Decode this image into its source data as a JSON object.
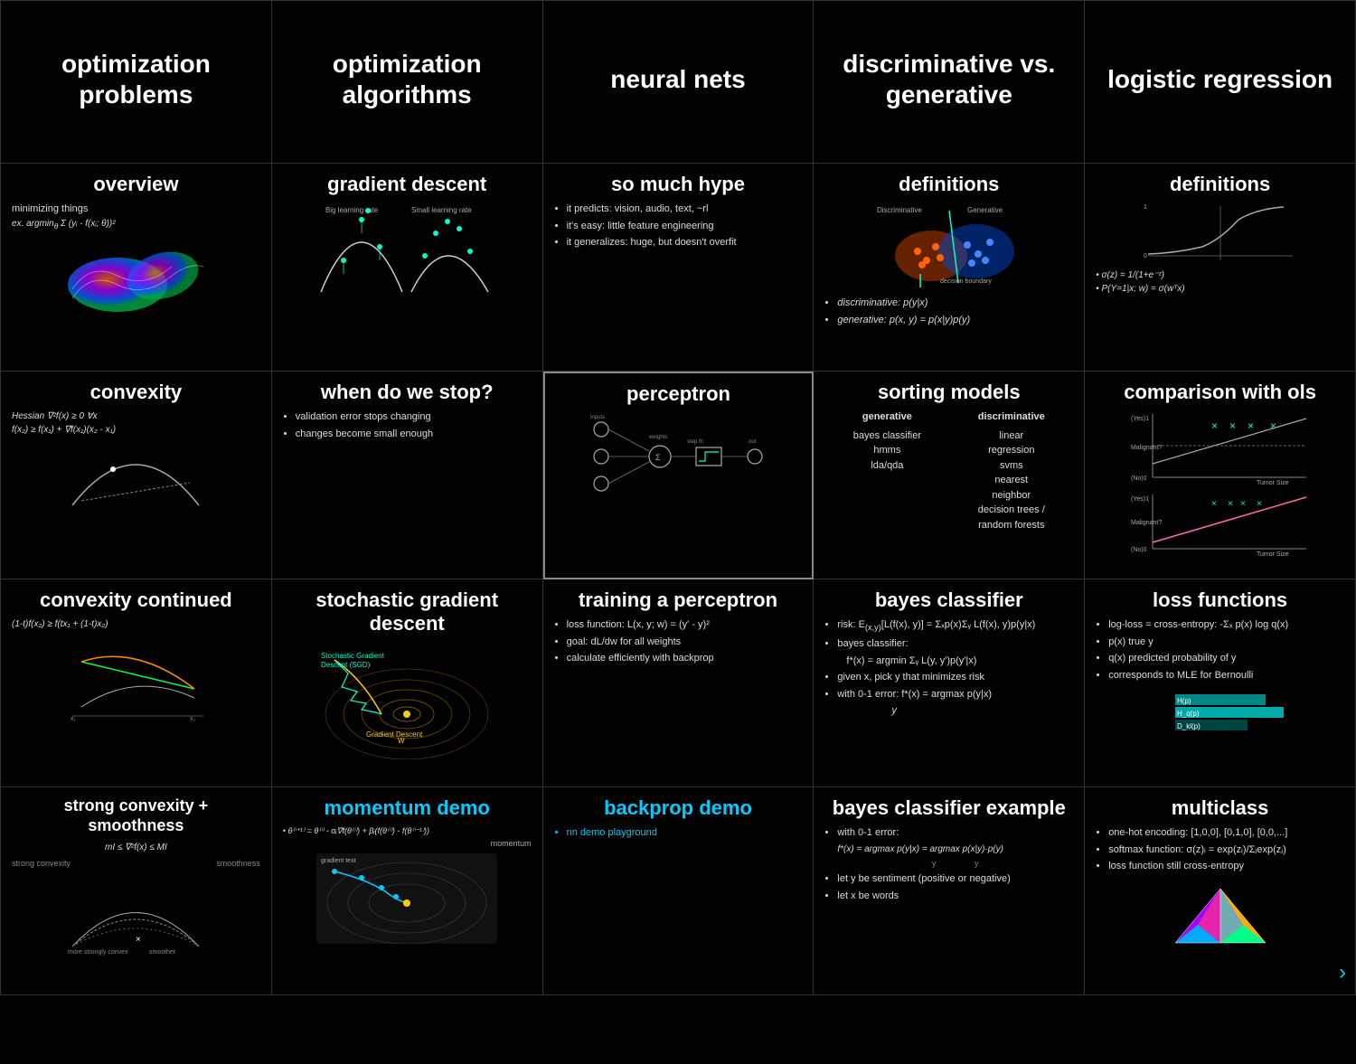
{
  "topics": [
    {
      "id": "opt-problems",
      "title": "optimization\nproblems",
      "row": 0
    },
    {
      "id": "opt-algorithms",
      "title": "optimization\nalgorithms",
      "row": 0
    },
    {
      "id": "neural-nets",
      "title": "neural nets",
      "row": 0
    },
    {
      "id": "disc-gen",
      "title": "discriminative vs.\ngenerative",
      "row": 0
    },
    {
      "id": "logistic-reg",
      "title": "logistic regression",
      "row": 0
    }
  ],
  "cells": [
    {
      "id": "overview",
      "title": "overview",
      "row": 1,
      "col": 0,
      "body": "minimizing things",
      "formula": "ex. argmin Σ(yᵢ - f(xᵢ; θ))²"
    },
    {
      "id": "gradient-descent",
      "title": "gradient descent",
      "row": 1,
      "col": 1,
      "labels": [
        "Big learning rate",
        "Small learning rate"
      ]
    },
    {
      "id": "so-much-hype",
      "title": "so much hype",
      "row": 1,
      "col": 2,
      "bullets": [
        "it predicts: vision, audio, text, ~rl",
        "it's easy: little feature engineering",
        "it generalizes: huge, but doesn't overfit"
      ]
    },
    {
      "id": "definitions-disc",
      "title": "definitions",
      "row": 1,
      "col": 3,
      "labels": [
        "Discriminative",
        "Generative",
        "decision boundary"
      ],
      "bullets": [
        "discriminative: p(y|x)",
        "generative: p(x, y) = p(x|y)p(y)"
      ]
    },
    {
      "id": "definitions-logistic",
      "title": "definitions",
      "row": 1,
      "col": 4,
      "formulas": [
        "σ(z) = 1/(1+e⁻ᶻ)",
        "P(Y=1|x; w) = σ(wᵀx)"
      ]
    },
    {
      "id": "convexity",
      "title": "convexity",
      "row": 2,
      "col": 0,
      "formulas": [
        "Hessian ∇²f(x) ≥ 0 ∀x",
        "f(x₂) ≥ f(x₁) + ∇f(x₁)(x₂ - x₁)"
      ]
    },
    {
      "id": "when-stop",
      "title": "when do we stop?",
      "row": 2,
      "col": 1,
      "bullets": [
        "validation error stops changing",
        "changes become small enough"
      ]
    },
    {
      "id": "perceptron",
      "title": "perceptron",
      "row": 2,
      "col": 2,
      "highlighted": true,
      "labels": [
        "inputs",
        "weights",
        "weighted sum",
        "step function",
        "output"
      ]
    },
    {
      "id": "sorting-models",
      "title": "sorting models",
      "row": 2,
      "col": 3,
      "generative": [
        "bayes classifier",
        "hmms",
        "lda/qda"
      ],
      "discriminative": [
        "linear",
        "regression",
        "svms",
        "nearest",
        "neighbor",
        "decision trees /",
        "random forests"
      ]
    },
    {
      "id": "comparison-ols",
      "title": "comparison with ols",
      "row": 2,
      "col": 4,
      "labels": [
        "(Yes) 1",
        "Malignant ?",
        "(No) 0",
        "Tumor Size",
        "x × × ×"
      ]
    },
    {
      "id": "convexity-cont",
      "title": "convexity continued",
      "row": 3,
      "col": 0,
      "formula": "(1-t)f(x₂) ≥ f(tx₁ + (1-t)x₂)"
    },
    {
      "id": "sgd",
      "title": "stochastic gradient descent",
      "row": 3,
      "col": 1,
      "labels": [
        "Stochastic Gradient Descent (SGD)",
        "Gradient Descent",
        "W"
      ]
    },
    {
      "id": "training-perceptron",
      "title": "training a perceptron",
      "row": 3,
      "col": 2,
      "bullets": [
        "loss function: L(x, y; w) = (y' - y)²",
        "goal: dL/dw for all weights",
        "calculate efficiently with backprop"
      ]
    },
    {
      "id": "bayes-classifier",
      "title": "bayes classifier",
      "row": 3,
      "col": 3,
      "bullets": [
        "risk: E(x,y)[L(f(x), y)] = Σₓp(x)Σᵧ L(f(x), y)p(y|x)",
        "bayes classifier:",
        "f*(x) = argmin Σᵧ L(y, y')p(y'|x)",
        "given x, pick y that minimizes risk",
        "with 0-1 error: f*(x) = argmax p(y|x)"
      ]
    },
    {
      "id": "loss-functions",
      "title": "loss functions",
      "row": 3,
      "col": 4,
      "bullets": [
        "log-loss = cross-entropy: -Σₓ p(x) log q(x)",
        "p(x) true y",
        "q(x) predicted probability of y",
        "corresponds to MLE for Bernoulli"
      ],
      "chart_labels": [
        "H(p)",
        "H_q(p)",
        "D_kl(p)"
      ]
    },
    {
      "id": "strong-convexity",
      "title": "strong convexity +\nsmoothness",
      "row": 4,
      "col": 0,
      "formula": "mI ≤ ∇²f(x) ≤ MI\nstrong convexity   smoothness"
    },
    {
      "id": "momentum-demo",
      "title": "momentum demo",
      "row": 4,
      "col": 1,
      "cyan": true,
      "formula": "θ⁽ⁱ⁺¹⁾ = θ⁽ⁱ⁾ - αᵢ∇f(θ⁽ⁱ⁾) + βᵢ(f(θ⁽ⁱ⁾) - f(θ⁽ⁱ⁻¹⁾))\nmomentum"
    },
    {
      "id": "backprop-demo",
      "title": "backprop demo",
      "row": 4,
      "col": 2,
      "cyan": true,
      "link": "nn demo playground"
    },
    {
      "id": "bayes-example",
      "title": "bayes classifier example",
      "row": 4,
      "col": 3,
      "bullets": [
        "with 0-1 error:",
        "f*(x) = argmax p(y|x) = argmax p(x|y)·p(y)",
        "let y be sentiment (positive or negative)",
        "let x be words"
      ]
    },
    {
      "id": "multiclass",
      "title": "multiclass",
      "row": 4,
      "col": 4,
      "bullets": [
        "one-hot encoding: [1,0,0], [0,1,0], [0,0,...]",
        "softmax function: σ(z)ᵢ = exp(zᵢ)/Σⱼexp(zⱼ)",
        "loss function still cross-entropy"
      ]
    }
  ],
  "nav": {
    "arrow_label": "›"
  }
}
